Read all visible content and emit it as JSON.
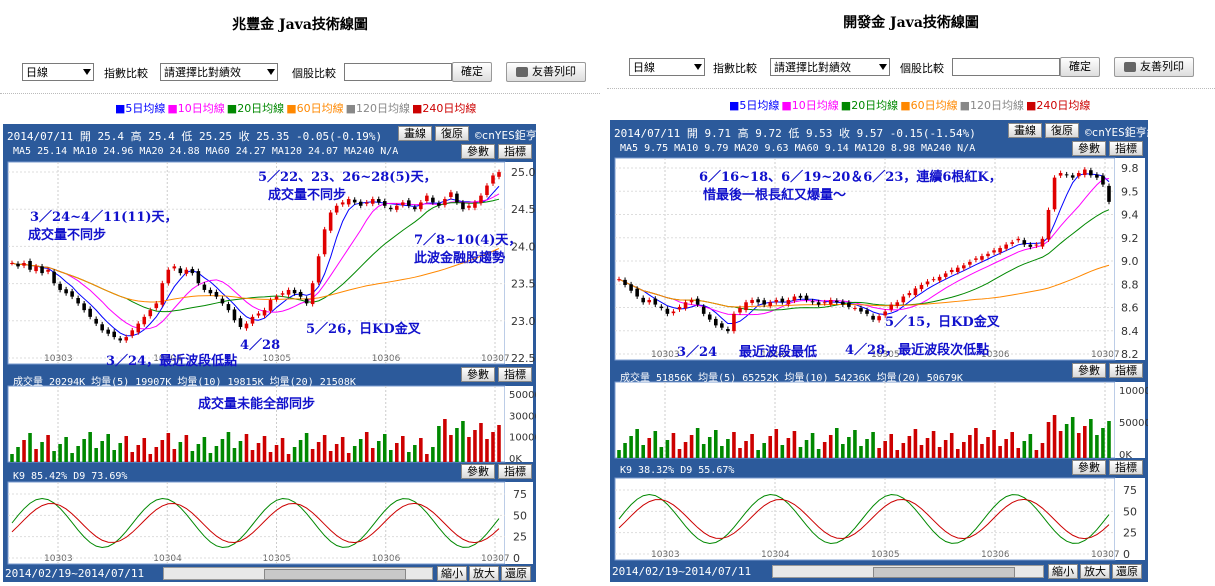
{
  "left": {
    "title": "兆豐金 Java技術線圖",
    "period_select": "日線",
    "index_label": "指數比較",
    "compare_select": "請選擇比對績效",
    "stock_label": "個股比較",
    "confirm_label": "確定",
    "print_label": "友善列印",
    "ma_legend": [
      "■5日均線",
      "■10日均線",
      "■20日均線",
      "■60日均線",
      "■120日均線",
      "■240日均線"
    ],
    "header1": "2014/07/11 開 25.4 高 25.4 低 25.25 收 25.35 -0.05(-0.19%)",
    "header2": "MA5 25.14   MA10 24.96   MA20 24.88   MA60 24.27   MA120 24.07   MA240 N/A",
    "draw_btn": "畫線",
    "restore_btn": "復原",
    "credit": "©cnYES鉅亨網",
    "param_btn": "參數",
    "indicator_btn": "指標",
    "price_ticks": [
      "25.0",
      "24.5",
      "24.0",
      "23.5",
      "23.0",
      "22.5"
    ],
    "month_ticks": [
      "10303",
      "10304",
      "10305",
      "10306",
      "10307"
    ],
    "volume_header": "成交量 20294K   均量(5) 19907K   均量(10) 19815K   均量(20) 21508K",
    "volume_ticks": [
      "50000K",
      "30000K",
      "10000K",
      "0K"
    ],
    "kd_header": "K9 85.42%   D9 73.69%",
    "kd_ticks": [
      "75",
      "50",
      "25",
      "0"
    ],
    "date_range": "2014/02/19~2014/07/11",
    "shrink_btn": "縮小",
    "zoom_btn": "放大",
    "reset_btn": "還原",
    "annotations": {
      "a1": "5／22、23、26~28(5)天，",
      "a2": "成交量不同步",
      "a3": "3／24~4／11(11)天，",
      "a4": "成交量不同步",
      "a5": "7／8~10(4)天，",
      "a6": "此波金融股趨勢",
      "a7": "5／26，日KD金叉",
      "a8": "4／28",
      "a9": "3／24，最近波段低點",
      "a10": "成交量未能全部同步"
    }
  },
  "right": {
    "title": "開發金 Java技術線圖",
    "period_select": "日線",
    "index_label": "指數比較",
    "compare_select": "請選擇比對績效",
    "stock_label": "個股比較",
    "confirm_label": "確定",
    "print_label": "友善列印",
    "ma_legend": [
      "■5日均線",
      "■10日均線",
      "■20日均線",
      "■60日均線",
      "■120日均線",
      "■240日均線"
    ],
    "header1": "2014/07/11 開 9.71 高 9.72 低 9.53 收 9.57 -0.15(-1.54%)",
    "header2": "MA5 9.75  MA10 9.79  MA20 9.63  MA60 9.14  MA120 8.98  MA240 N/A",
    "draw_btn": "畫線",
    "restore_btn": "復原",
    "credit": "©cnYES鉅亨網",
    "param_btn": "參數",
    "indicator_btn": "指標",
    "price_ticks": [
      "9.8",
      "9.5",
      "9.4",
      "9.2",
      "9.0",
      "8.8",
      "8.6",
      "8.4",
      "8.2"
    ],
    "month_ticks": [
      "10303",
      "10304",
      "10305",
      "10306",
      "10307"
    ],
    "volume_header": "成交量 51856K   均量(5) 65252K   均量(10) 54236K   均量(20) 50679K",
    "volume_ticks": [
      "100000K",
      "50000K",
      "0K"
    ],
    "kd_header": "K9 38.32%   D9 55.67%",
    "kd_ticks": [
      "75",
      "50",
      "25",
      "0"
    ],
    "date_range": "2014/02/19~2014/07/11",
    "shrink_btn": "縮小",
    "zoom_btn": "放大",
    "reset_btn": "還原",
    "annotations": {
      "a1": "6／16~18、6／19~20＆6／23，連續6根紅K，",
      "a2": "惜最後一根長紅又爆量～",
      "a3": "5／15，日KD金叉",
      "a4": "3／24",
      "a5": "最近波段最低",
      "a6": "4／28，最近波段次低點"
    }
  },
  "colors": {
    "panel_bg": "#2c5a9b",
    "plot_bg": "#ffffff",
    "up": "#e00000",
    "down": "#000000",
    "ma5": "#0000ff",
    "ma10": "#ff00ff",
    "ma20": "#008800",
    "ma60": "#ff8800",
    "ma120": "#888888",
    "ma240": "#cc0000",
    "vol_green": "#008800",
    "vol_red": "#cc0000",
    "annotation": "#1111cc",
    "box": "#ff66ff"
  },
  "chart_data": [
    {
      "type": "candlestick",
      "title": "兆豐金 Java技術線圖",
      "x_range": [
        "2014/02/19",
        "2014/07/11"
      ],
      "ylim": [
        22.5,
        25.5
      ],
      "last": {
        "open": 25.4,
        "high": 25.4,
        "low": 25.25,
        "close": 25.35
      },
      "close": [
        24.0,
        23.95,
        24.0,
        23.9,
        23.95,
        23.85,
        23.9,
        23.7,
        23.6,
        23.55,
        23.5,
        23.4,
        23.3,
        23.2,
        23.1,
        23.0,
        22.95,
        22.9,
        22.85,
        22.9,
        23.0,
        23.1,
        23.2,
        23.3,
        23.4,
        23.7,
        23.9,
        23.95,
        23.85,
        23.9,
        23.85,
        23.7,
        23.6,
        23.55,
        23.5,
        23.4,
        23.3,
        23.15,
        23.05,
        23.1,
        23.2,
        23.25,
        23.3,
        23.45,
        23.5,
        23.55,
        23.6,
        23.55,
        23.5,
        23.4,
        23.7,
        24.1,
        24.5,
        24.75,
        24.85,
        24.9,
        24.95,
        24.9,
        24.85,
        24.9,
        24.95,
        24.9,
        24.85,
        24.8,
        24.85,
        24.9,
        24.85,
        24.8,
        24.9,
        25.0,
        24.9,
        24.85,
        24.95,
        25.05,
        24.9,
        24.8,
        24.85,
        24.9,
        25.0,
        25.15,
        25.3,
        25.35
      ]
    },
    {
      "type": "candlestick",
      "title": "開發金 Java技術線圖",
      "x_range": [
        "2014/02/19",
        "2014/07/11"
      ],
      "ylim": [
        8.2,
        9.95
      ],
      "last": {
        "open": 9.71,
        "high": 9.72,
        "low": 9.53,
        "close": 9.57
      },
      "close": [
        8.9,
        8.85,
        8.8,
        8.75,
        8.7,
        8.72,
        8.68,
        8.65,
        8.6,
        8.62,
        8.66,
        8.7,
        8.72,
        8.68,
        8.6,
        8.55,
        8.5,
        8.48,
        8.45,
        8.6,
        8.65,
        8.7,
        8.72,
        8.7,
        8.68,
        8.7,
        8.72,
        8.7,
        8.72,
        8.75,
        8.74,
        8.72,
        8.7,
        8.68,
        8.7,
        8.72,
        8.7,
        8.68,
        8.66,
        8.65,
        8.62,
        8.6,
        8.55,
        8.58,
        8.62,
        8.68,
        8.7,
        8.75,
        8.78,
        8.82,
        8.85,
        8.88,
        8.9,
        8.92,
        8.95,
        8.98,
        9.0,
        9.02,
        9.05,
        9.08,
        9.1,
        9.12,
        9.15,
        9.17,
        9.2,
        9.22,
        9.25,
        9.2,
        9.18,
        9.2,
        9.25,
        9.5,
        9.78,
        9.82,
        9.8,
        9.78,
        9.82,
        9.85,
        9.8,
        9.78,
        9.72,
        9.57
      ]
    }
  ]
}
